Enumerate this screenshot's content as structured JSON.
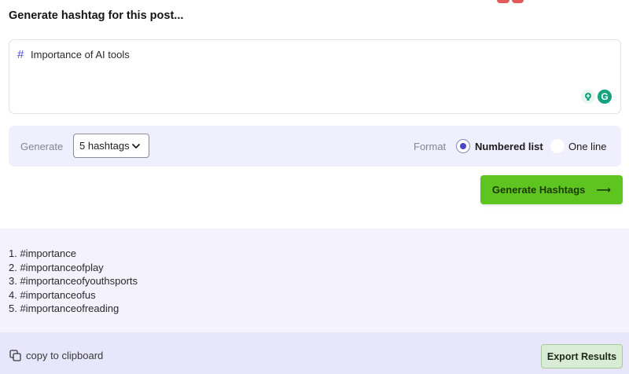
{
  "heading": "Generate hashtag for this post...",
  "prompt": {
    "hash_symbol": "#",
    "value": "Importance of AI tools",
    "extension_icons": [
      "lightbulb-plus-icon",
      "grammarly-icon"
    ],
    "grammarly_glyph": "G"
  },
  "options": {
    "generate_label": "Generate",
    "count_select": {
      "selected": "5 hashtags"
    },
    "format_label": "Format",
    "format_options": [
      {
        "label": "Numbered list",
        "checked": true
      },
      {
        "label": "One line",
        "checked": false
      }
    ]
  },
  "generate_button": {
    "label": "Generate Hashtags",
    "arrow": "⟶"
  },
  "results": {
    "items": [
      "1. #importance",
      "2. #importanceofplay",
      "3. #importanceofyouthsports",
      "4. #importanceofus",
      "5. #importanceofreading"
    ]
  },
  "footer": {
    "copy_label": "copy to clipboard",
    "export_label": "Export Results"
  },
  "colors": {
    "accent_purple": "#4a46c8",
    "generate_green": "#5ec41f",
    "options_bg": "#f0effd",
    "results_bg": "#f3f2fd",
    "footer_bg": "#e8e6fb",
    "export_bg": "#d9ecd6"
  }
}
